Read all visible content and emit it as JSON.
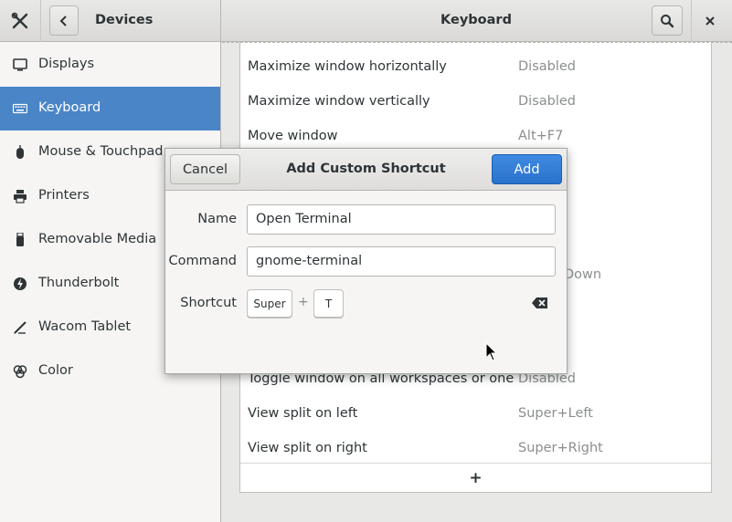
{
  "header": {
    "left_title": "Devices",
    "title": "Keyboard"
  },
  "sidebar": {
    "items": [
      {
        "label": "Displays",
        "icon": "display-icon"
      },
      {
        "label": "Keyboard",
        "icon": "keyboard-icon",
        "active": true
      },
      {
        "label": "Mouse & Touchpad",
        "icon": "mouse-icon"
      },
      {
        "label": "Printers",
        "icon": "printer-icon"
      },
      {
        "label": "Removable Media",
        "icon": "usb-drive-icon"
      },
      {
        "label": "Thunderbolt",
        "icon": "thunderbolt-icon"
      },
      {
        "label": "Wacom Tablet",
        "icon": "tablet-icon"
      },
      {
        "label": "Color",
        "icon": "color-icon"
      }
    ]
  },
  "shortcuts": [
    {
      "name": "Maximize window horizontally",
      "value": "Disabled"
    },
    {
      "name": "Maximize window vertically",
      "value": "Disabled"
    },
    {
      "name": "Move window",
      "value": "Alt+F7"
    },
    {
      "name": "Toggle window on all workspaces or one",
      "value": "Disabled"
    },
    {
      "name": "View split on left",
      "value": "Super+Left"
    },
    {
      "name": "View split on right",
      "value": "Super+Right"
    }
  ],
  "partial_values": {
    "down_fragment": "Down"
  },
  "add_row_label": "+",
  "dialog": {
    "title": "Add Custom Shortcut",
    "cancel_label": "Cancel",
    "add_label": "Add",
    "name_label": "Name",
    "name_value": "Open Terminal",
    "command_label": "Command",
    "command_value": "gnome-terminal",
    "shortcut_label": "Shortcut",
    "shortcut_keys": [
      "Super",
      "T"
    ],
    "key_separator": "+"
  },
  "colors": {
    "accent": "#4a85c7",
    "add_button": "#2f78d2"
  }
}
